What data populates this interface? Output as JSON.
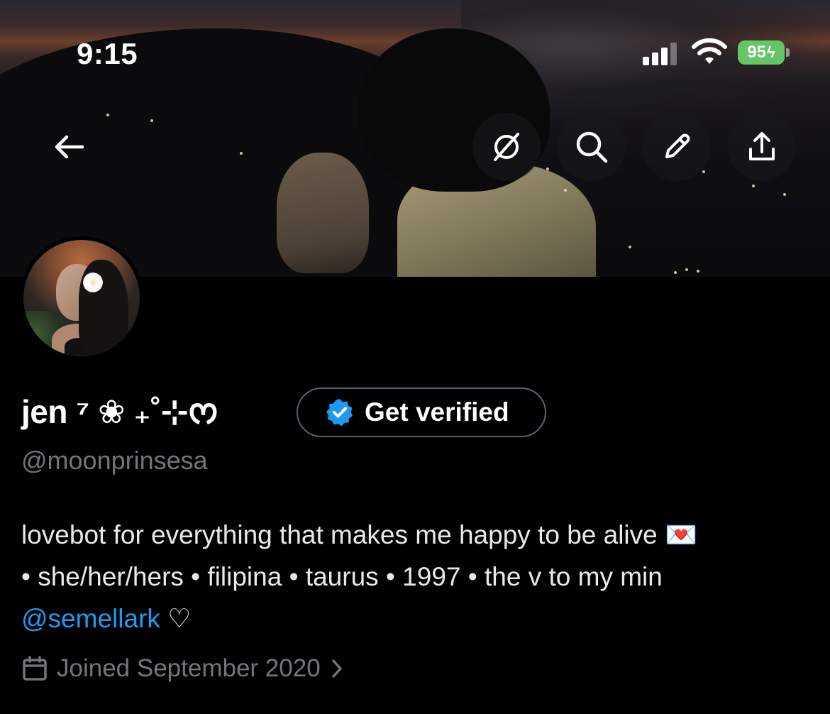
{
  "status_bar": {
    "time": "9:15",
    "battery": "95"
  },
  "header": {
    "back_icon": "arrow-left-icon",
    "actions": [
      "grok-icon",
      "search-icon",
      "pencil-icon",
      "share-icon"
    ]
  },
  "profile": {
    "display_name": "jen ⁷ ❀ ₊˚⊹ᰔ",
    "get_verified_label": "Get verified",
    "handle": "@moonprinsesa",
    "bio": {
      "line1": "lovebot for everything that makes me happy to be alive 💌",
      "line2": "• she/her/hers • filipina • taurus • 1997 • the v to my min",
      "mention": "@semellark",
      "after_mention": " ♡"
    },
    "joined": "Joined September 2020"
  },
  "colors": {
    "background": "#000000",
    "text_primary": "#e7e9ea",
    "text_secondary": "#71767b",
    "link": "#1d9bf0",
    "verified_badge": "#1d9bf0",
    "battery": "#65c466"
  }
}
